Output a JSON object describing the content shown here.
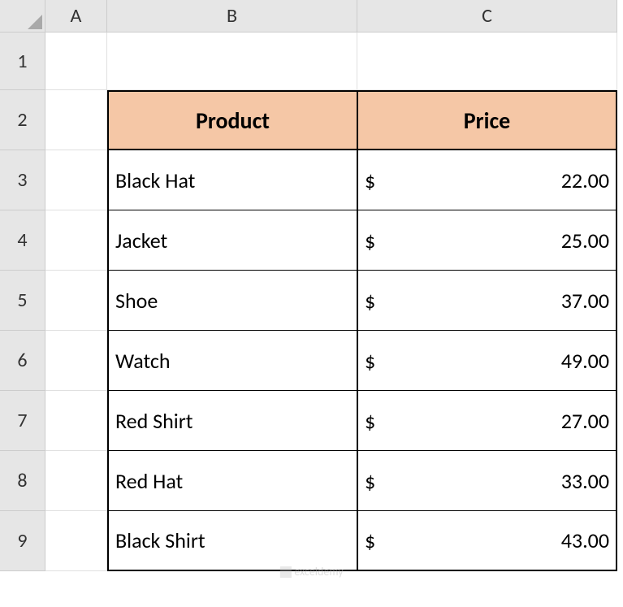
{
  "columns": [
    "A",
    "B",
    "C"
  ],
  "rows": [
    "1",
    "2",
    "3",
    "4",
    "5",
    "6",
    "7",
    "8",
    "9"
  ],
  "headers": {
    "product": "Product",
    "price": "Price"
  },
  "currency_symbol": "$",
  "data": [
    {
      "product": "Black Hat",
      "price": "22.00"
    },
    {
      "product": "Jacket",
      "price": "25.00"
    },
    {
      "product": "Shoe",
      "price": "37.00"
    },
    {
      "product": "Watch",
      "price": "49.00"
    },
    {
      "product": "Red Shirt",
      "price": "27.00"
    },
    {
      "product": "Red Hat",
      "price": "33.00"
    },
    {
      "product": "Black Shirt",
      "price": "43.00"
    }
  ],
  "watermark": "exceldemy",
  "chart_data": {
    "type": "table",
    "title": "",
    "columns": [
      "Product",
      "Price"
    ],
    "rows": [
      [
        "Black Hat",
        22.0
      ],
      [
        "Jacket",
        25.0
      ],
      [
        "Shoe",
        37.0
      ],
      [
        "Watch",
        49.0
      ],
      [
        "Red Shirt",
        27.0
      ],
      [
        "Red Hat",
        33.0
      ],
      [
        "Black Shirt",
        43.0
      ]
    ],
    "currency": "USD"
  }
}
